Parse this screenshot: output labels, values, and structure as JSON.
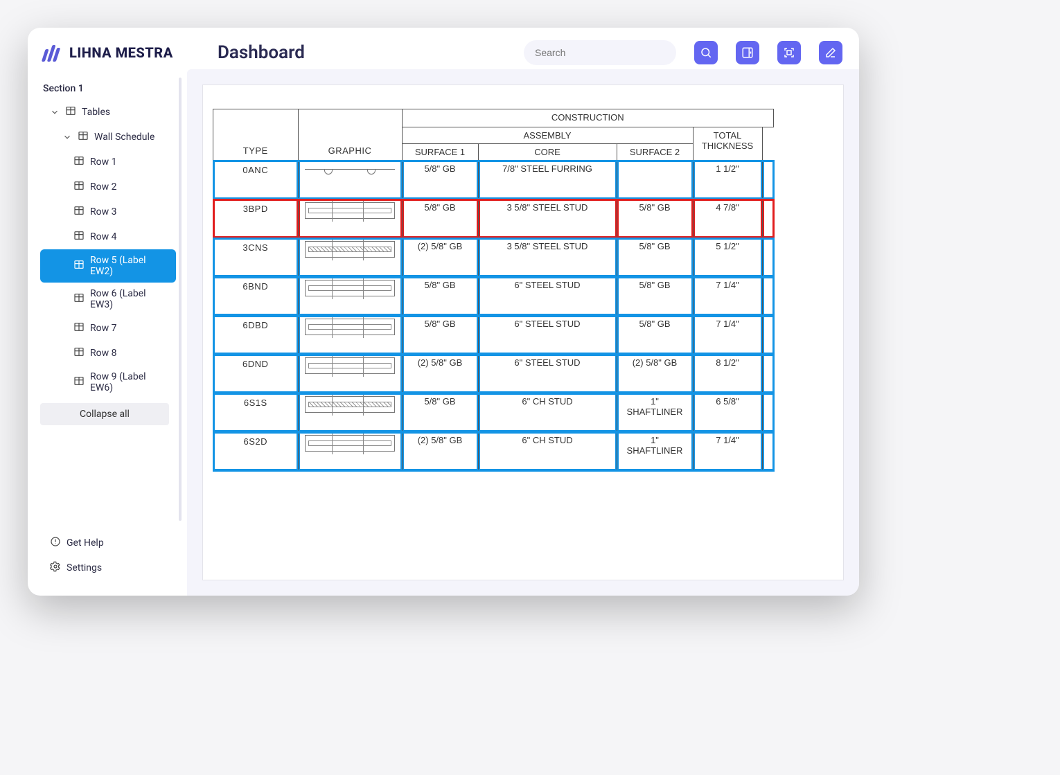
{
  "brand": "LIHNA MESTRA",
  "page_title": "Dashboard",
  "search": {
    "placeholder": "Search"
  },
  "sidebar": {
    "section_label": "Section 1",
    "tables_label": "Tables",
    "wall_schedule_label": "Wall Schedule",
    "rows": [
      {
        "label": "Row 1"
      },
      {
        "label": "Row 2"
      },
      {
        "label": "Row 3"
      },
      {
        "label": "Row 4"
      },
      {
        "label": "Row 5 (Label EW2)",
        "active": true
      },
      {
        "label": "Row 6 (Label EW3)"
      },
      {
        "label": "Row 7"
      },
      {
        "label": "Row 8"
      },
      {
        "label": "Row 9 (Label EW6)"
      }
    ],
    "collapse_label": "Collapse all",
    "help_label": "Get Help",
    "settings_label": "Settings"
  },
  "schedule": {
    "headers": {
      "construction": "CONSTRUCTION",
      "assembly": "ASSEMBLY",
      "type": "TYPE",
      "graphic": "GRAPHIC",
      "surface1": "SURFACE 1",
      "core": "CORE",
      "surface2": "SURFACE 2",
      "total_thickness": "TOTAL THICKNESS"
    },
    "rows": [
      {
        "type": "0ANC",
        "graphic": "furring",
        "s1": "5/8\" GB",
        "core": "7/8\" STEEL FURRING",
        "s2": "",
        "tt": "1 1/2\"",
        "hl": "blue"
      },
      {
        "type": "3BPD",
        "graphic": "stud",
        "s1": "5/8\" GB",
        "core": "3 5/8\" STEEL STUD",
        "s2": "5/8\" GB",
        "tt": "4 7/8\"",
        "hl": "red"
      },
      {
        "type": "3CNS",
        "graphic": "hatched",
        "s1": "(2) 5/8\" GB",
        "core": "3 5/8\" STEEL STUD",
        "s2": "5/8\" GB",
        "tt": "5 1/2\"",
        "hl": "blue"
      },
      {
        "type": "6BND",
        "graphic": "stud",
        "s1": "5/8\" GB",
        "core": "6\" STEEL STUD",
        "s2": "5/8\" GB",
        "tt": "7 1/4\"",
        "hl": "blue"
      },
      {
        "type": "6DBD",
        "graphic": "stud",
        "s1": "5/8\" GB",
        "core": "6\" STEEL STUD",
        "s2": "5/8\" GB",
        "tt": "7 1/4\"",
        "hl": "blue"
      },
      {
        "type": "6DND",
        "graphic": "stud",
        "s1": "(2) 5/8\" GB",
        "core": "6\" STEEL STUD",
        "s2": "(2) 5/8\" GB",
        "tt": "8 1/2\"",
        "hl": "blue"
      },
      {
        "type": "6S1S",
        "graphic": "hatched",
        "s1": "5/8\" GB",
        "core": "6\" CH STUD",
        "s2": "1\" SHAFTLINER",
        "tt": "6 5/8\"",
        "hl": "blue"
      },
      {
        "type": "6S2D",
        "graphic": "stud",
        "s1": "(2) 5/8\" GB",
        "core": "6\" CH STUD",
        "s2": "1\" SHAFTLINER",
        "tt": "7 1/4\"",
        "hl": "blue"
      }
    ]
  }
}
